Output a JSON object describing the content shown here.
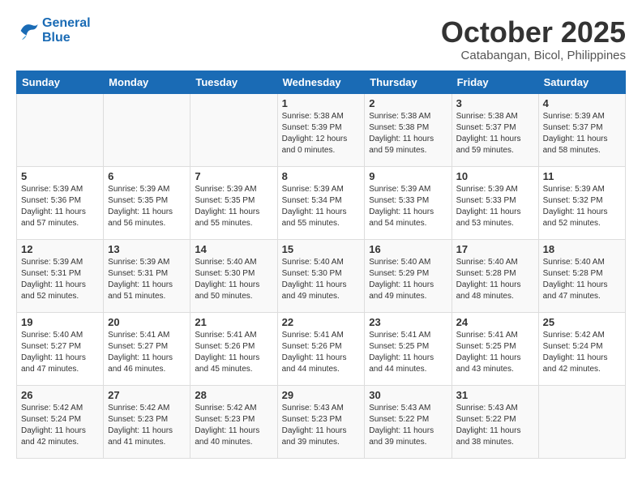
{
  "header": {
    "logo_line1": "General",
    "logo_line2": "Blue",
    "month": "October 2025",
    "location": "Catabangan, Bicol, Philippines"
  },
  "weekdays": [
    "Sunday",
    "Monday",
    "Tuesday",
    "Wednesday",
    "Thursday",
    "Friday",
    "Saturday"
  ],
  "weeks": [
    [
      {
        "day": "",
        "info": ""
      },
      {
        "day": "",
        "info": ""
      },
      {
        "day": "",
        "info": ""
      },
      {
        "day": "1",
        "info": "Sunrise: 5:38 AM\nSunset: 5:39 PM\nDaylight: 12 hours\nand 0 minutes."
      },
      {
        "day": "2",
        "info": "Sunrise: 5:38 AM\nSunset: 5:38 PM\nDaylight: 11 hours\nand 59 minutes."
      },
      {
        "day": "3",
        "info": "Sunrise: 5:38 AM\nSunset: 5:37 PM\nDaylight: 11 hours\nand 59 minutes."
      },
      {
        "day": "4",
        "info": "Sunrise: 5:39 AM\nSunset: 5:37 PM\nDaylight: 11 hours\nand 58 minutes."
      }
    ],
    [
      {
        "day": "5",
        "info": "Sunrise: 5:39 AM\nSunset: 5:36 PM\nDaylight: 11 hours\nand 57 minutes."
      },
      {
        "day": "6",
        "info": "Sunrise: 5:39 AM\nSunset: 5:35 PM\nDaylight: 11 hours\nand 56 minutes."
      },
      {
        "day": "7",
        "info": "Sunrise: 5:39 AM\nSunset: 5:35 PM\nDaylight: 11 hours\nand 55 minutes."
      },
      {
        "day": "8",
        "info": "Sunrise: 5:39 AM\nSunset: 5:34 PM\nDaylight: 11 hours\nand 55 minutes."
      },
      {
        "day": "9",
        "info": "Sunrise: 5:39 AM\nSunset: 5:33 PM\nDaylight: 11 hours\nand 54 minutes."
      },
      {
        "day": "10",
        "info": "Sunrise: 5:39 AM\nSunset: 5:33 PM\nDaylight: 11 hours\nand 53 minutes."
      },
      {
        "day": "11",
        "info": "Sunrise: 5:39 AM\nSunset: 5:32 PM\nDaylight: 11 hours\nand 52 minutes."
      }
    ],
    [
      {
        "day": "12",
        "info": "Sunrise: 5:39 AM\nSunset: 5:31 PM\nDaylight: 11 hours\nand 52 minutes."
      },
      {
        "day": "13",
        "info": "Sunrise: 5:39 AM\nSunset: 5:31 PM\nDaylight: 11 hours\nand 51 minutes."
      },
      {
        "day": "14",
        "info": "Sunrise: 5:40 AM\nSunset: 5:30 PM\nDaylight: 11 hours\nand 50 minutes."
      },
      {
        "day": "15",
        "info": "Sunrise: 5:40 AM\nSunset: 5:30 PM\nDaylight: 11 hours\nand 49 minutes."
      },
      {
        "day": "16",
        "info": "Sunrise: 5:40 AM\nSunset: 5:29 PM\nDaylight: 11 hours\nand 49 minutes."
      },
      {
        "day": "17",
        "info": "Sunrise: 5:40 AM\nSunset: 5:28 PM\nDaylight: 11 hours\nand 48 minutes."
      },
      {
        "day": "18",
        "info": "Sunrise: 5:40 AM\nSunset: 5:28 PM\nDaylight: 11 hours\nand 47 minutes."
      }
    ],
    [
      {
        "day": "19",
        "info": "Sunrise: 5:40 AM\nSunset: 5:27 PM\nDaylight: 11 hours\nand 47 minutes."
      },
      {
        "day": "20",
        "info": "Sunrise: 5:41 AM\nSunset: 5:27 PM\nDaylight: 11 hours\nand 46 minutes."
      },
      {
        "day": "21",
        "info": "Sunrise: 5:41 AM\nSunset: 5:26 PM\nDaylight: 11 hours\nand 45 minutes."
      },
      {
        "day": "22",
        "info": "Sunrise: 5:41 AM\nSunset: 5:26 PM\nDaylight: 11 hours\nand 44 minutes."
      },
      {
        "day": "23",
        "info": "Sunrise: 5:41 AM\nSunset: 5:25 PM\nDaylight: 11 hours\nand 44 minutes."
      },
      {
        "day": "24",
        "info": "Sunrise: 5:41 AM\nSunset: 5:25 PM\nDaylight: 11 hours\nand 43 minutes."
      },
      {
        "day": "25",
        "info": "Sunrise: 5:42 AM\nSunset: 5:24 PM\nDaylight: 11 hours\nand 42 minutes."
      }
    ],
    [
      {
        "day": "26",
        "info": "Sunrise: 5:42 AM\nSunset: 5:24 PM\nDaylight: 11 hours\nand 42 minutes."
      },
      {
        "day": "27",
        "info": "Sunrise: 5:42 AM\nSunset: 5:23 PM\nDaylight: 11 hours\nand 41 minutes."
      },
      {
        "day": "28",
        "info": "Sunrise: 5:42 AM\nSunset: 5:23 PM\nDaylight: 11 hours\nand 40 minutes."
      },
      {
        "day": "29",
        "info": "Sunrise: 5:43 AM\nSunset: 5:23 PM\nDaylight: 11 hours\nand 39 minutes."
      },
      {
        "day": "30",
        "info": "Sunrise: 5:43 AM\nSunset: 5:22 PM\nDaylight: 11 hours\nand 39 minutes."
      },
      {
        "day": "31",
        "info": "Sunrise: 5:43 AM\nSunset: 5:22 PM\nDaylight: 11 hours\nand 38 minutes."
      },
      {
        "day": "",
        "info": ""
      }
    ]
  ]
}
